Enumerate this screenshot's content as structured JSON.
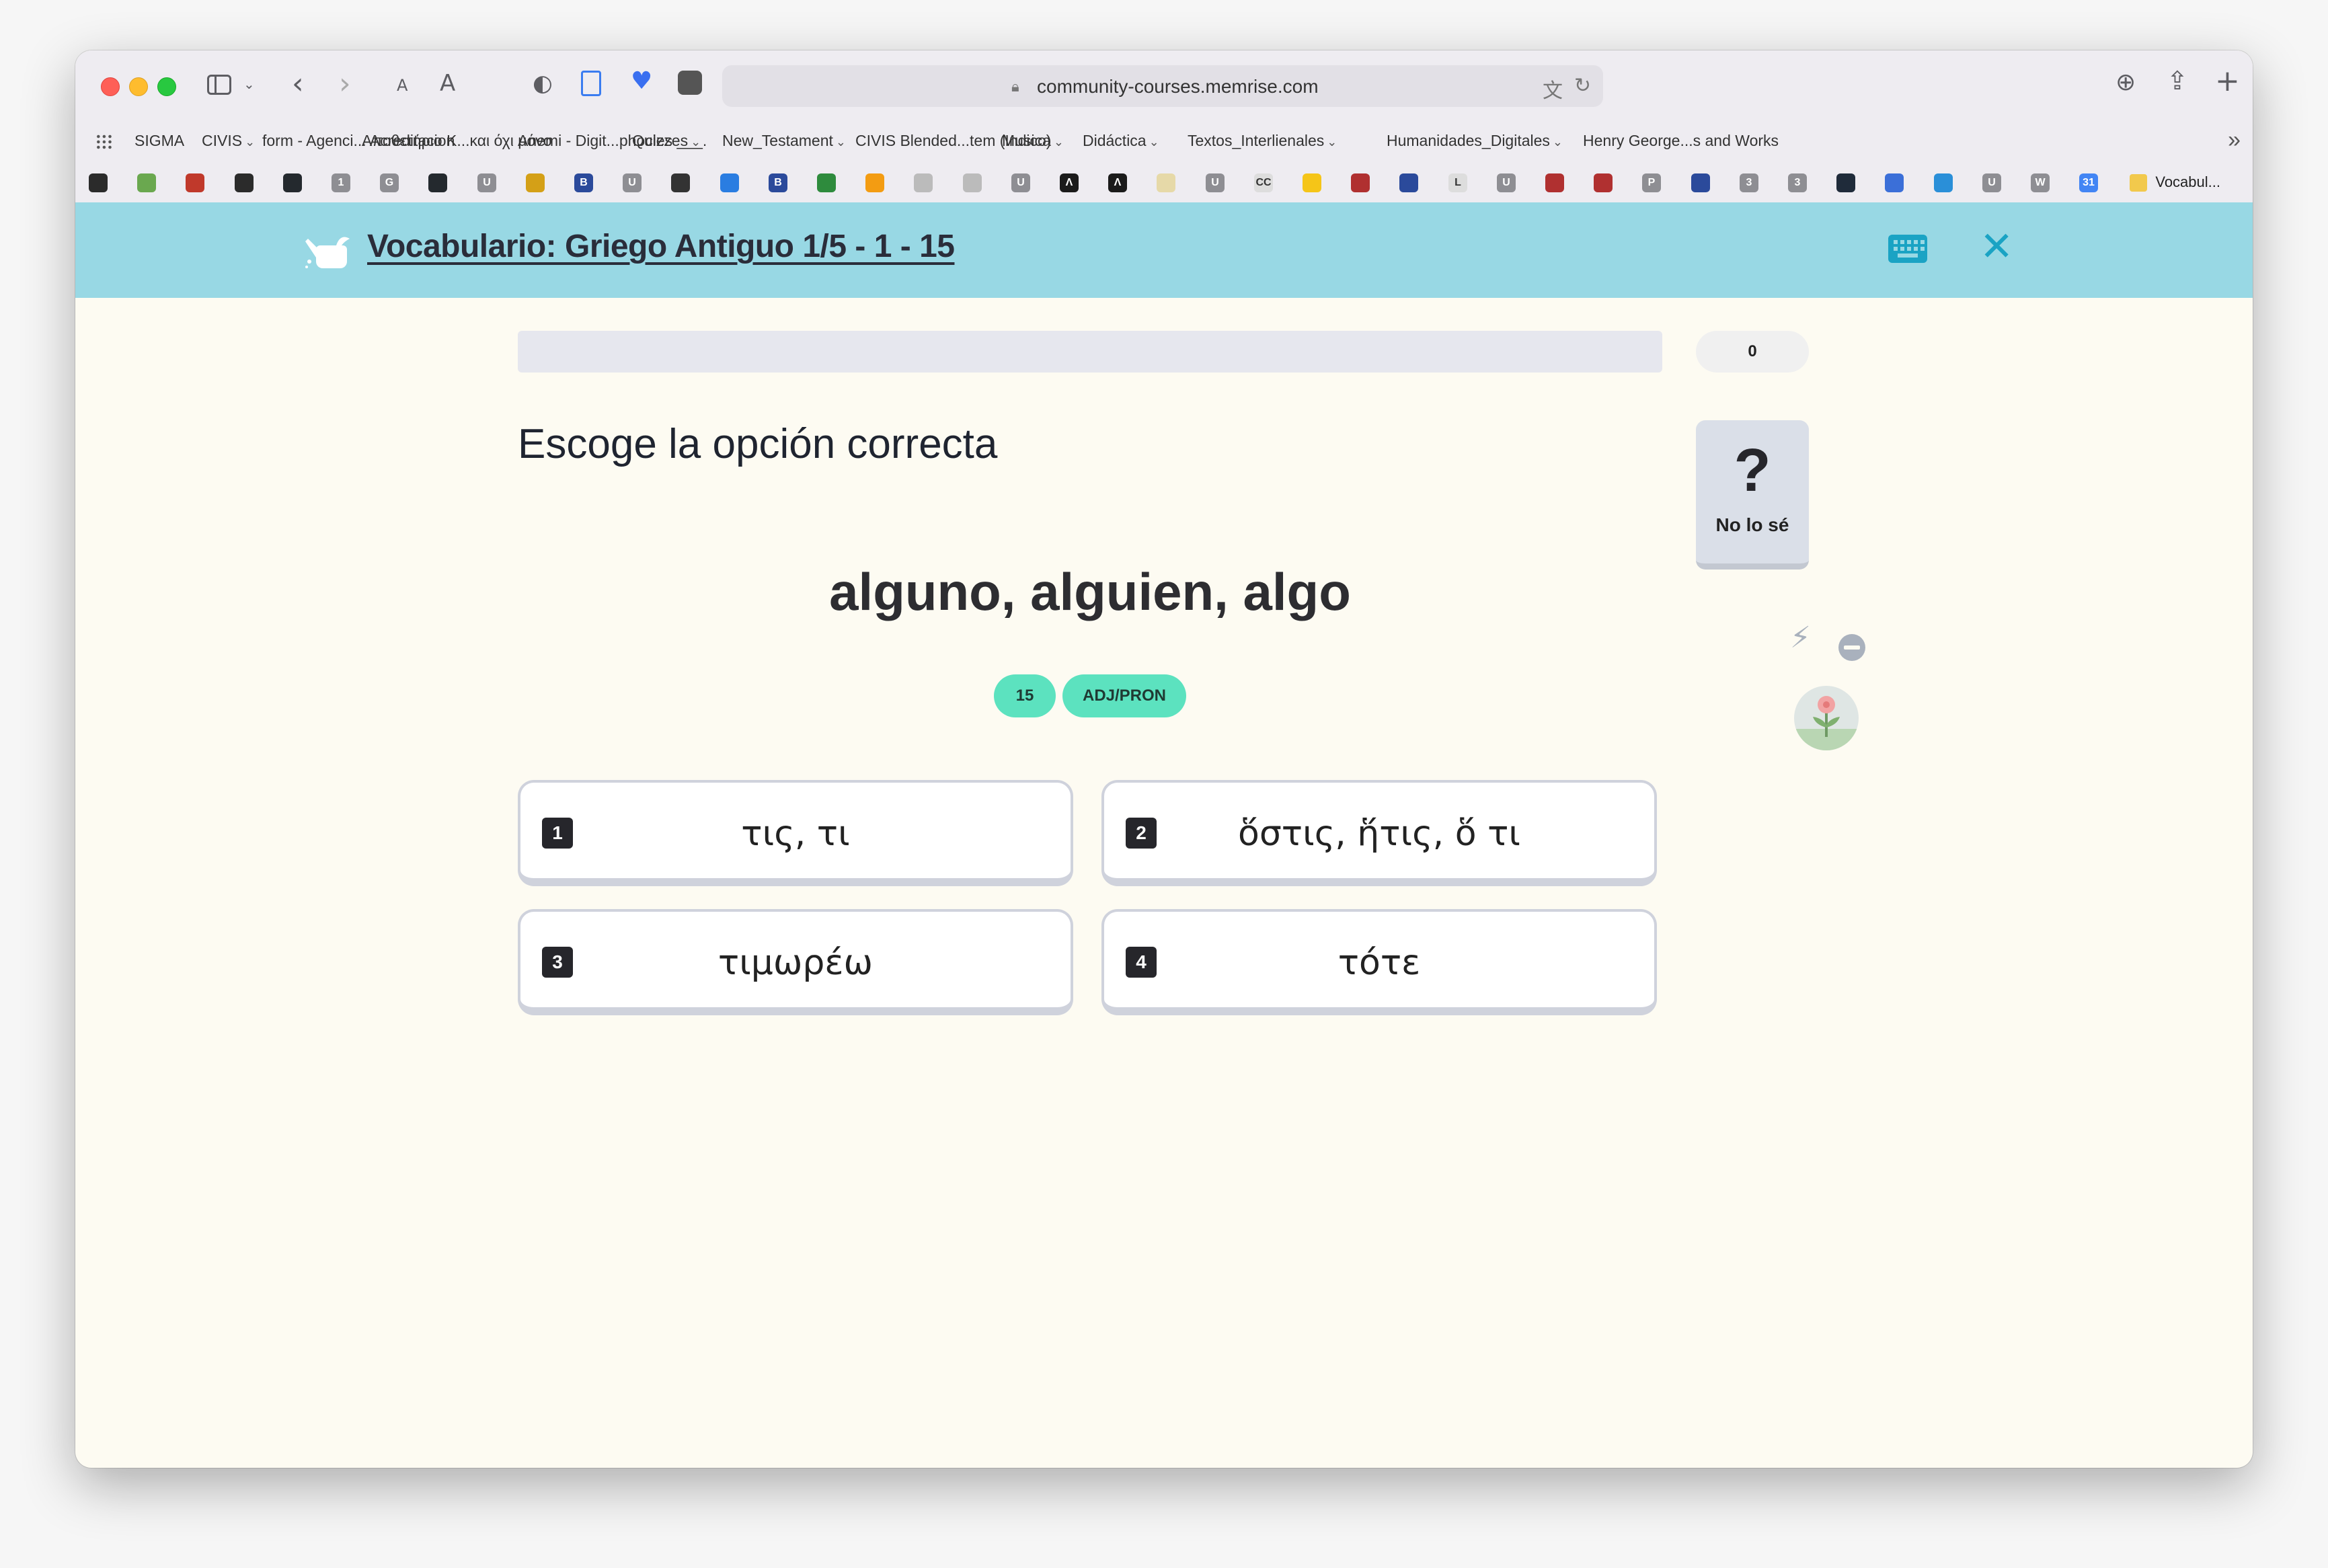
{
  "browser": {
    "url": "community-courses.memrise.com",
    "favorites": [
      {
        "label": "SIGMA",
        "has_menu": false
      },
      {
        "label": "CIVIS",
        "has_menu": true
      },
      {
        "label": "form - Agenci... Acreditacion",
        "has_menu": false
      },
      {
        "label": "Αποθετήριο Κ...και όχι μόνο",
        "has_menu": false
      },
      {
        "label": "Anemi - Digit...phocles ___.",
        "has_menu": false
      },
      {
        "label": "Quizzes",
        "has_menu": true
      },
      {
        "label": "New_Testament",
        "has_menu": true
      },
      {
        "label": "CIVIS Blended...tem (Indico)",
        "has_menu": false
      },
      {
        "label": "Musica",
        "has_menu": true
      },
      {
        "label": "Didáctica",
        "has_menu": true
      },
      {
        "label": "Textos_Interlienales",
        "has_menu": true
      },
      {
        "label": "Humanidades_Digitales",
        "has_menu": true
      },
      {
        "label": "Henry George...s and Works",
        "has_menu": false
      }
    ],
    "icon_bookmarks": [
      {
        "glyph": "",
        "color": "#2b2b2b"
      },
      {
        "glyph": "",
        "color": "#6aa84f"
      },
      {
        "glyph": "",
        "color": "#c0392b"
      },
      {
        "glyph": "",
        "color": "#2b2b2b"
      },
      {
        "glyph": "",
        "color": "#24292e"
      },
      {
        "glyph": "1",
        "color": "#8e8e93"
      },
      {
        "glyph": "G",
        "color": "#8e8e93"
      },
      {
        "glyph": "",
        "color": "#24292e"
      },
      {
        "glyph": "U",
        "color": "#8e8e93"
      },
      {
        "glyph": "",
        "color": "#d4a017"
      },
      {
        "glyph": "B",
        "color": "#2b4a9b"
      },
      {
        "glyph": "U",
        "color": "#8e8e93"
      },
      {
        "glyph": "",
        "color": "#333333"
      },
      {
        "glyph": "",
        "color": "#2a7de1"
      },
      {
        "glyph": "B",
        "color": "#2b4a9b"
      },
      {
        "glyph": "",
        "color": "#2e8b3d"
      },
      {
        "glyph": "",
        "color": "#f39c12"
      },
      {
        "glyph": "",
        "color": "#bbbbbb"
      },
      {
        "glyph": "",
        "color": "#bbbbbb"
      },
      {
        "glyph": "U",
        "color": "#8e8e93"
      },
      {
        "glyph": "Λ",
        "color": "#1b1b1b"
      },
      {
        "glyph": "Λ",
        "color": "#1b1b1b"
      },
      {
        "glyph": "",
        "color": "#e6d9a8"
      },
      {
        "glyph": "U",
        "color": "#8e8e93"
      },
      {
        "glyph": "CC",
        "color": "#dddddd"
      },
      {
        "glyph": "",
        "color": "#f5c518"
      },
      {
        "glyph": "",
        "color": "#b03030"
      },
      {
        "glyph": "",
        "color": "#2b4a9b"
      },
      {
        "glyph": "L",
        "color": "#dddddd"
      },
      {
        "glyph": "U",
        "color": "#8e8e93"
      },
      {
        "glyph": "",
        "color": "#b03030"
      },
      {
        "glyph": "",
        "color": "#b03030"
      },
      {
        "glyph": "P",
        "color": "#8e8e93"
      },
      {
        "glyph": "",
        "color": "#2b4a9b"
      },
      {
        "glyph": "3",
        "color": "#8e8e93"
      },
      {
        "glyph": "3",
        "color": "#8e8e93"
      },
      {
        "glyph": "",
        "color": "#1f2b3a"
      },
      {
        "glyph": "",
        "color": "#3b6fd8"
      },
      {
        "glyph": "",
        "color": "#2a8fd8"
      },
      {
        "glyph": "U",
        "color": "#8e8e93"
      },
      {
        "glyph": "W",
        "color": "#8e8e93"
      },
      {
        "glyph": "31",
        "color": "#4285f4"
      }
    ],
    "last_bookmark": "Vocabul..."
  },
  "course": {
    "title": "Vocabulario: Griego Antiguo 1/5 - 1 - 15"
  },
  "session": {
    "progress_fraction": 0,
    "score": "0",
    "instruction": "Escoge la opción correcta",
    "prompt": "alguno, alguien, algo",
    "tags": [
      "15",
      "ADJ/PRON"
    ],
    "dont_know_label": "No lo sé",
    "options": [
      {
        "key": "1",
        "text": "τις, τι"
      },
      {
        "key": "2",
        "text": "ὅστις, ἥτις, ὅ τι"
      },
      {
        "key": "3",
        "text": "τιμωρέω"
      },
      {
        "key": "4",
        "text": "τότε"
      }
    ]
  },
  "colors": {
    "header_bg": "#98d8e4",
    "accent": "#1aa3c4",
    "tag_bg": "#5ce2bf",
    "page_bg": "#fdfbf2"
  }
}
